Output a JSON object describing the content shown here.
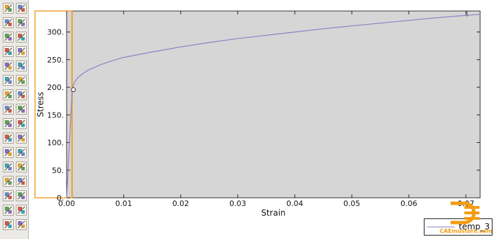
{
  "toolbox": {
    "tools": [
      {
        "left": "xy-data-manager-icon",
        "right": "grid-layout-icon"
      },
      {
        "left": "xy-plot-icon",
        "right": "plot-options-icon"
      },
      {
        "left": "axis-tool-icon",
        "right": "axis-list-icon"
      },
      {
        "left": "curve-style-icon",
        "right": "curve-list-icon"
      },
      {
        "left": "chart-edit-icon",
        "right": "chart-list-icon"
      },
      {
        "left": "chart-options-icon",
        "right": "chart-tree-icon"
      },
      {
        "left": "contour-plot-icon",
        "right": "contour-options-icon"
      },
      {
        "left": "path-plot-icon",
        "right": "path-list-icon"
      },
      {
        "left": "node-plot-icon",
        "right": "table-icon"
      },
      {
        "left": "spreadsheet-icon",
        "right": "report-table-icon"
      },
      {
        "left": "path-arrow-icon",
        "right": "path-curve-icon"
      },
      {
        "left": "animate-icon",
        "right": "animate-options-icon"
      },
      {
        "left": "section-icon",
        "right": "section-table-icon"
      },
      {
        "left": "probe-icon",
        "right": "probe-table-icon"
      },
      {
        "left": "view-cut-icon",
        "right": "view-cut-table-icon"
      },
      {
        "left": "display-group-icon",
        "right": "display-table-icon"
      }
    ]
  },
  "chart_data": {
    "type": "line",
    "title": "",
    "xlabel": "Strain",
    "ylabel": "Stress",
    "xlim": [
      0,
      0.0725
    ],
    "ylim": [
      0,
      338
    ],
    "xticks": [
      "0.00",
      "0.01",
      "0.02",
      "0.03",
      "0.04",
      "0.05",
      "0.06",
      "0.07"
    ],
    "xtick_values": [
      0,
      0.01,
      0.02,
      0.03,
      0.04,
      0.05,
      0.06,
      0.07
    ],
    "yticks": [
      "0.",
      "50.",
      "100.",
      "150.",
      "200.",
      "250.",
      "300."
    ],
    "ytick_values": [
      0,
      50,
      100,
      150,
      200,
      250,
      300
    ],
    "plot_background": "#d6d6d6",
    "grid": false,
    "legend_position": "bottom-right",
    "series": [
      {
        "name": "temp_3",
        "color": "#8f7fc6",
        "x": [
          0,
          0.0002,
          0.0004,
          0.0006,
          0.0008,
          0.0009,
          0.00095,
          0.001,
          0.0012,
          0.0015,
          0.002,
          0.003,
          0.004,
          0.006,
          0.008,
          0.01,
          0.015,
          0.02,
          0.025,
          0.03,
          0.035,
          0.04,
          0.045,
          0.05,
          0.055,
          0.06,
          0.065,
          0.07,
          0.0725
        ],
        "y": [
          0,
          40,
          80,
          120,
          160,
          180,
          190,
          196,
          205,
          211,
          218,
          226,
          232,
          241,
          248,
          254,
          264,
          273,
          281,
          288,
          294,
          300,
          306,
          311,
          316,
          321,
          326,
          330,
          332
        ]
      }
    ],
    "selection_box_color": "#f0a030",
    "selection_strain_marker": 0.00095,
    "marker_point": {
      "x": 0.00095,
      "y": 198
    }
  },
  "watermark": {
    "text": "CAEmustore.com",
    "color": "#f39c12"
  }
}
